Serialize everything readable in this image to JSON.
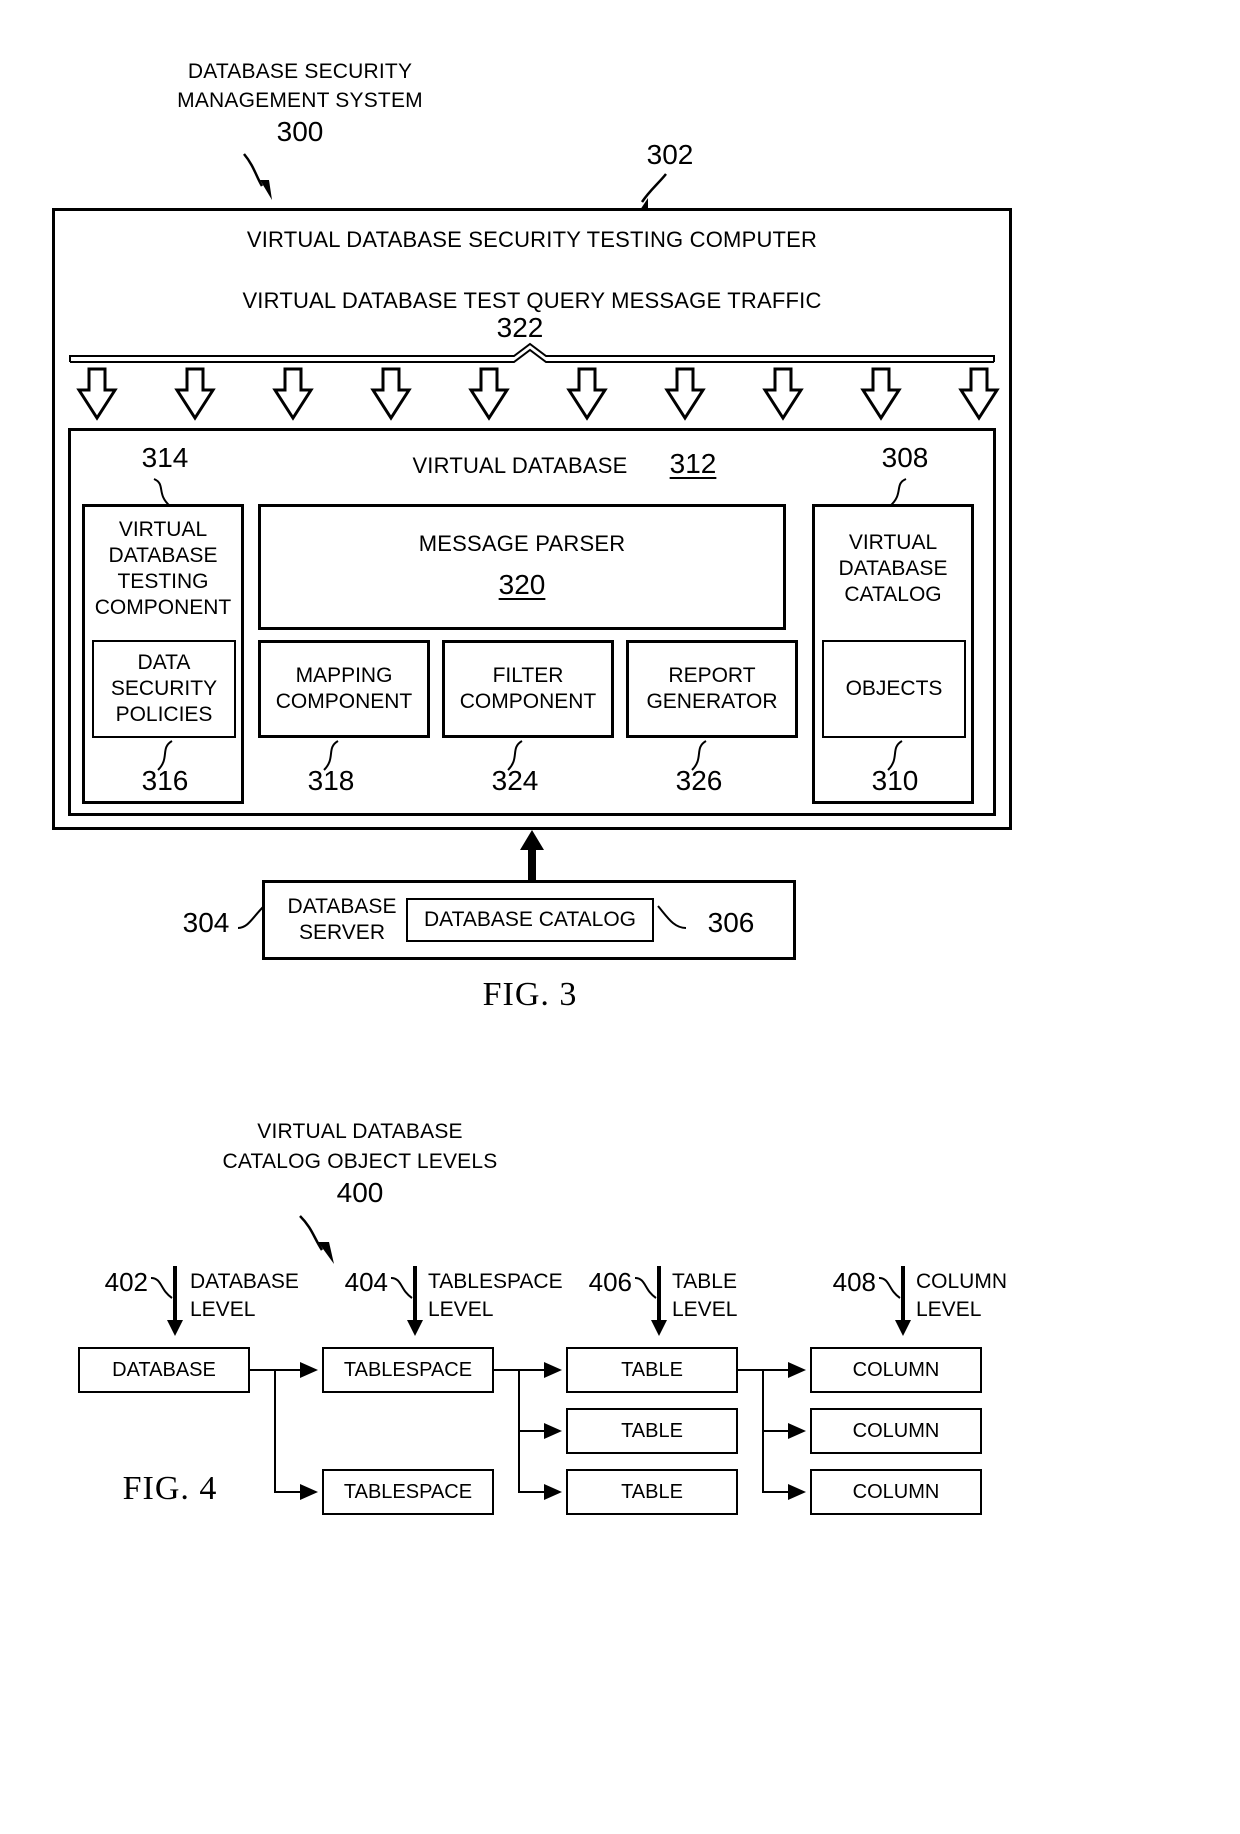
{
  "figure3": {
    "title_lines": [
      "DATABASE SECURITY",
      "MANAGEMENT SYSTEM"
    ],
    "title_ref": "300",
    "outer_ref": "302",
    "outer_heading": "VIRTUAL DATABASE SECURITY TESTING COMPUTER",
    "traffic_label": "VIRTUAL DATABASE TEST QUERY MESSAGE TRAFFIC",
    "traffic_ref": "322",
    "arrow_count": 10,
    "inner_heading": "VIRTUAL DATABASE",
    "inner_ref": "312",
    "testing_component": {
      "label": "VIRTUAL DATABASE TESTING COMPONENT",
      "ref": "314",
      "child": {
        "label": "DATA SECURITY POLICIES",
        "ref": "316"
      }
    },
    "message_parser": {
      "label": "MESSAGE PARSER",
      "ref": "320"
    },
    "components": [
      {
        "label": "MAPPING COMPONENT",
        "ref": "318"
      },
      {
        "label": "FILTER COMPONENT",
        "ref": "324"
      },
      {
        "label": "REPORT GENERATOR",
        "ref": "326"
      }
    ],
    "catalog": {
      "label": "VIRTUAL DATABASE CATALOG",
      "ref": "308",
      "child": {
        "label": "OBJECTS",
        "ref": "310"
      }
    },
    "server": {
      "label": "DATABASE SERVER",
      "ref": "304",
      "child": {
        "label": "DATABASE CATALOG",
        "ref": "306"
      }
    },
    "fig_label": "FIG. 3"
  },
  "figure4": {
    "title_lines": [
      "VIRTUAL DATABASE",
      "CATALOG OBJECT LEVELS"
    ],
    "title_ref": "400",
    "fig_label": "FIG. 4",
    "levels": [
      {
        "ref": "402",
        "label_lines": [
          "DATABASE",
          "LEVEL"
        ]
      },
      {
        "ref": "404",
        "label_lines": [
          "TABLESPACE",
          "LEVEL"
        ]
      },
      {
        "ref": "406",
        "label_lines": [
          "TABLE",
          "LEVEL"
        ]
      },
      {
        "ref": "408",
        "label_lines": [
          "COLUMN",
          "LEVEL"
        ]
      }
    ],
    "columns": [
      {
        "name": "database",
        "boxes": [
          "DATABASE"
        ]
      },
      {
        "name": "tablespace",
        "boxes": [
          "TABLESPACE",
          "TABLESPACE"
        ]
      },
      {
        "name": "table",
        "boxes": [
          "TABLE",
          "TABLE",
          "TABLE"
        ]
      },
      {
        "name": "column",
        "boxes": [
          "COLUMN",
          "COLUMN",
          "COLUMN"
        ]
      }
    ]
  },
  "colors": {
    "ink": "#000000",
    "paper": "#ffffff"
  }
}
